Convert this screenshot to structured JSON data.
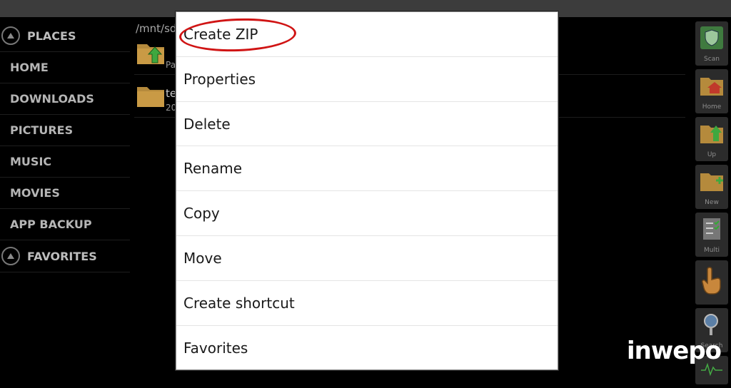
{
  "sidebar": {
    "places_label": "PLACES",
    "items": [
      "HOME",
      "DOWNLOADS",
      "PICTURES",
      "MUSIC",
      "MOVIES",
      "APP BACKUP"
    ],
    "favorites_label": "FAVORITES"
  },
  "file_area": {
    "path": "/mnt/sd",
    "rows": [
      {
        "name": "",
        "sub": "Pa"
      },
      {
        "name": "te",
        "sub": "20"
      }
    ]
  },
  "toolbar": {
    "items": [
      {
        "label": "Scan",
        "icon": "shield-icon"
      },
      {
        "label": "Home",
        "icon": "home-folder-icon"
      },
      {
        "label": "Up",
        "icon": "up-folder-icon"
      },
      {
        "label": "New",
        "icon": "new-folder-icon"
      },
      {
        "label": "Multi",
        "icon": "checklist-icon"
      },
      {
        "label": "",
        "icon": "hand-pointer-icon"
      },
      {
        "label": "Search",
        "icon": "magnifier-icon"
      },
      {
        "label": "",
        "icon": "graph-icon"
      }
    ]
  },
  "context_menu": {
    "items": [
      "Create ZIP",
      "Properties",
      "Delete",
      "Rename",
      "Copy",
      "Move",
      "Create shortcut",
      "Favorites"
    ]
  },
  "watermark": "inwepo",
  "colors": {
    "annotation": "#d01414",
    "folder": "#b58a3c",
    "dialog_bg": "#ffffff"
  }
}
